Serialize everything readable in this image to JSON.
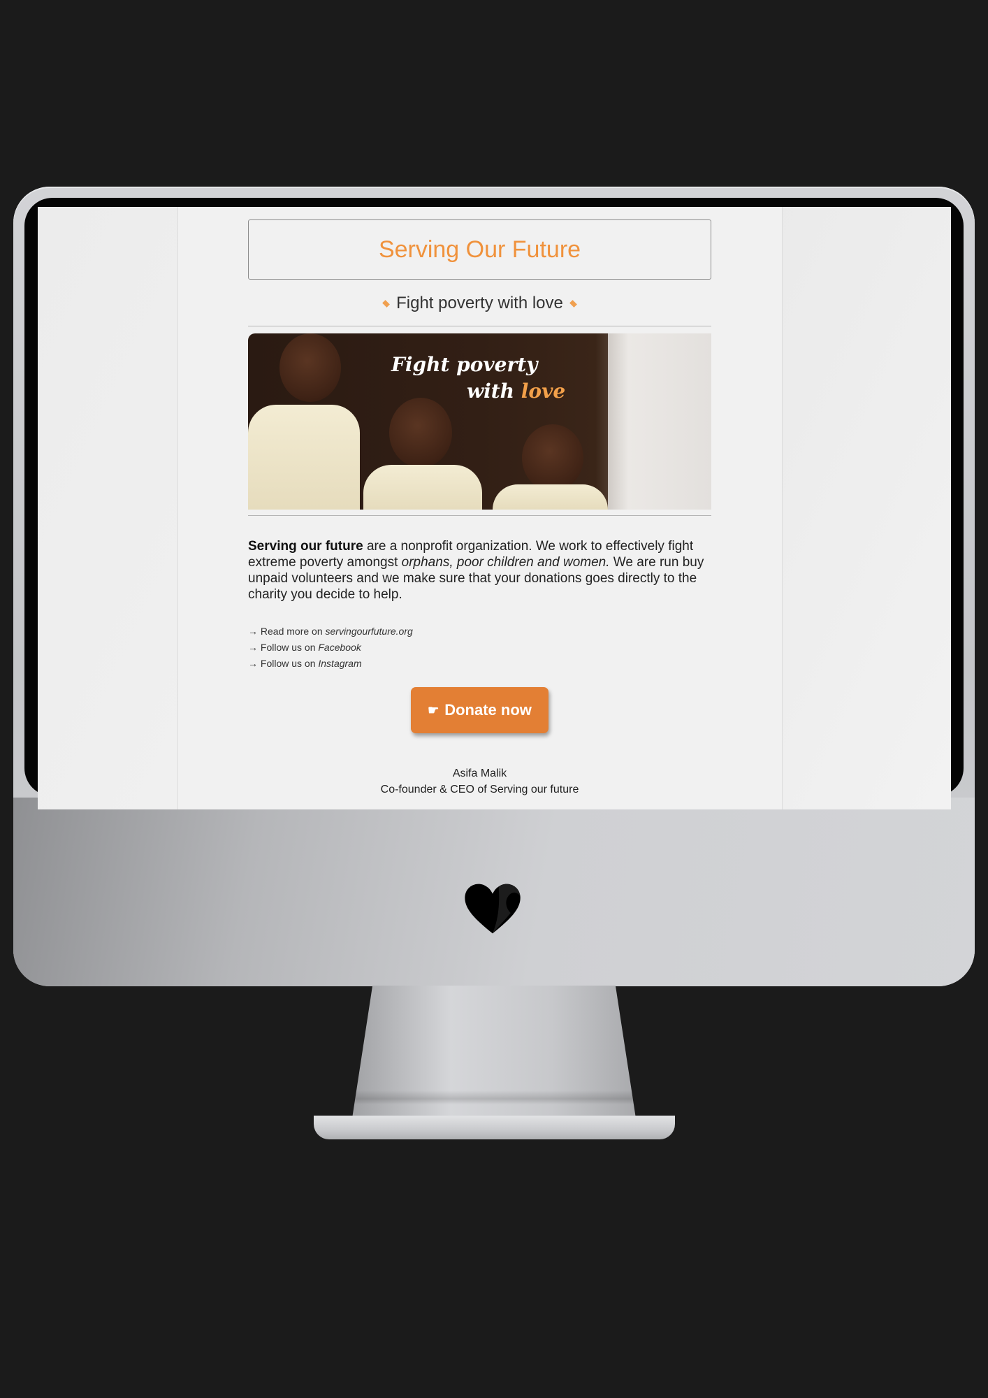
{
  "email": {
    "title": "Serving Our Future",
    "tagline": "Fight poverty with love",
    "hero": {
      "line1": "Fight poverty",
      "line2_prefix": "with ",
      "line2_highlight": "love"
    },
    "intro": {
      "bold": "Serving our future",
      "part1": " are a nonprofit organization. We work to effectively fight extreme poverty amongst ",
      "italic": "orphans, poor children and women.",
      "part2": " We are run buy unpaid volunteers and we make sure that your donations goes directly to the charity you decide to help."
    },
    "links": [
      {
        "arrow": "→",
        "prefix": "Read more on ",
        "target": "servingourfuture.org"
      },
      {
        "arrow": "→",
        "prefix": "Follow us on ",
        "target": "Facebook"
      },
      {
        "arrow": "→",
        "prefix": "Follow us on ",
        "target": "Instagram"
      }
    ],
    "donate_label": "Donate now",
    "donate_icon": "☛",
    "signature": {
      "name": "Asifa Malik",
      "role": "Co-founder & CEO of Serving our future"
    }
  },
  "colors": {
    "accent": "#f0923c",
    "button": "#e37f34",
    "background": "#1b1b1b"
  },
  "icons": {
    "brand_logo": "heart-logo-icon",
    "tagline_ornament": "diamond-icon",
    "donate": "pointing-hand-icon"
  }
}
